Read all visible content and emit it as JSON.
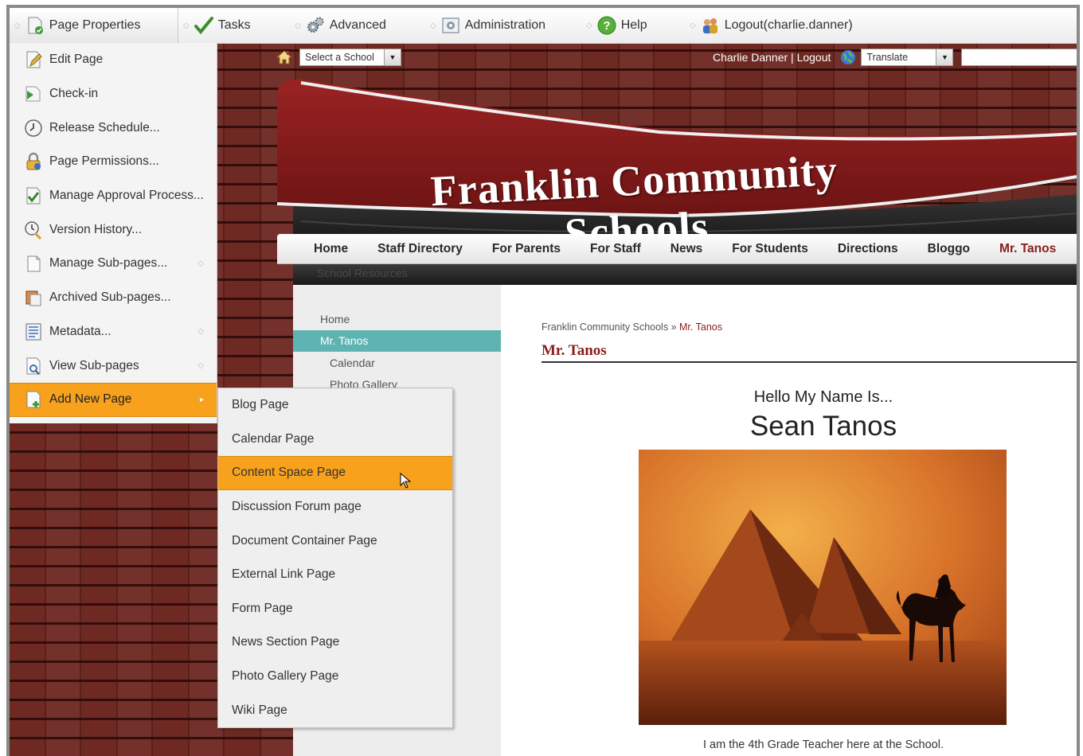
{
  "topbar": {
    "items": [
      {
        "label": "Page Properties",
        "icon": "page-properties-icon"
      },
      {
        "label": "Tasks",
        "icon": "tasks-checkmark-icon"
      },
      {
        "label": "Advanced",
        "icon": "advanced-gears-icon"
      },
      {
        "label": "Administration",
        "icon": "administration-icon"
      },
      {
        "label": "Help",
        "icon": "help-icon"
      },
      {
        "label": "Logout(charlie.danner)",
        "icon": "logout-users-icon"
      }
    ]
  },
  "page_menu": {
    "items": [
      {
        "label": "Edit Page",
        "icon": "edit-page-icon"
      },
      {
        "label": "Check-in",
        "icon": "check-in-icon"
      },
      {
        "label": "Release Schedule...",
        "icon": "clock-icon"
      },
      {
        "label": "Page Permissions...",
        "icon": "lock-icon"
      },
      {
        "label": "Manage Approval Process...",
        "icon": "approval-check-icon"
      },
      {
        "label": "Version History...",
        "icon": "version-history-icon"
      },
      {
        "label": "Manage Sub-pages...",
        "icon": "sub-pages-icon"
      },
      {
        "label": "Archived Sub-pages...",
        "icon": "archive-icon"
      },
      {
        "label": "Metadata...",
        "icon": "metadata-icon"
      },
      {
        "label": "View Sub-pages",
        "icon": "view-sub-pages-icon"
      },
      {
        "label": "Add New Page",
        "icon": "add-page-icon"
      }
    ]
  },
  "add_page_submenu": {
    "items": [
      "Blog Page",
      "Calendar Page",
      "Content Space Page",
      "Discussion Forum page",
      "Document Container Page",
      "External Link Page",
      "Form Page",
      "News Section Page",
      "Photo Gallery Page",
      "Wiki Page"
    ],
    "highlighted": "Content Space Page"
  },
  "util": {
    "school_select": "Select a School",
    "user_links": "Charlie Danner | Logout",
    "translate_select": "Translate",
    "search_value": ""
  },
  "banner": {
    "title": "Franklin Community Schools"
  },
  "nav": {
    "items": [
      "Home",
      "Staff Directory",
      "For Parents",
      "For Staff",
      "News",
      "For Students",
      "Directions",
      "Bloggo",
      "Mr. Tanos"
    ],
    "current": "Mr. Tanos",
    "hidden_text": "School Resources"
  },
  "subnav": {
    "items": [
      {
        "label": "Home",
        "level": 0
      },
      {
        "label": "Mr. Tanos",
        "level": 0
      },
      {
        "label": "Calendar",
        "level": 1
      },
      {
        "label": "Photo Gallery",
        "level": 1
      }
    ]
  },
  "content": {
    "breadcrumb_root": "Franklin Community Schools",
    "breadcrumb_sep": "»",
    "breadcrumb_current": "Mr. Tanos",
    "page_title": "Mr. Tanos",
    "hello": "Hello My Name Is...",
    "name": "Sean Tanos",
    "caption": "I am the 4th Grade Teacher here at the School."
  },
  "colors": {
    "menu_highlight": "#f7a11c",
    "brand_red": "#8b1c1c",
    "subnav_current": "#5fb4b3"
  }
}
